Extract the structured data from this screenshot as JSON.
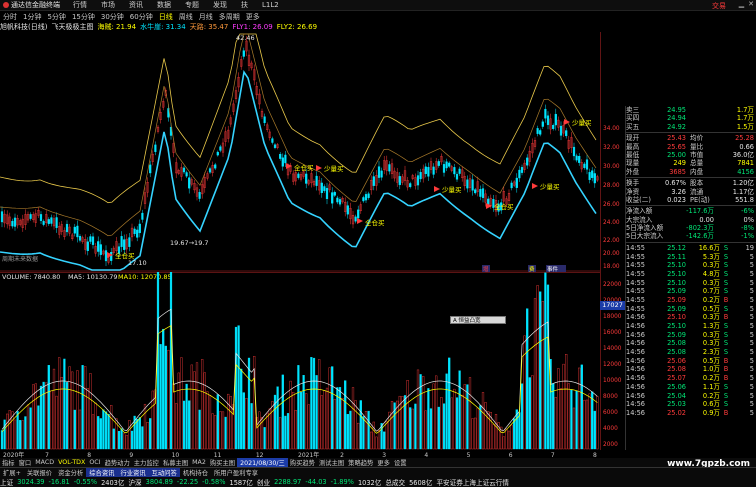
{
  "menubar": {
    "app_title": "通达信金融终端",
    "items": [
      "行情",
      "市场",
      "资讯",
      "数据",
      "专题",
      "发现",
      "扶",
      "L1L2"
    ],
    "brand": "交易"
  },
  "periods": [
    {
      "label": "分时",
      "active": false
    },
    {
      "label": "1分钟",
      "active": false
    },
    {
      "label": "5分钟",
      "active": false
    },
    {
      "label": "15分钟",
      "active": false
    },
    {
      "label": "30分钟",
      "active": false
    },
    {
      "label": "60分钟",
      "active": false
    },
    {
      "label": "日线",
      "active": true
    },
    {
      "label": "周线",
      "active": false
    },
    {
      "label": "月线",
      "active": false
    },
    {
      "label": "多周期",
      "active": false
    },
    {
      "label": "更多",
      "active": false
    }
  ],
  "legend": {
    "stock": "旭帆科技(日线)",
    "indicator": "飞天极极主图",
    "item1": "海贼: 21.94",
    "item2": "水牛崖: 31.34",
    "item3": "天路: 35.47",
    "item4": "FLY1: 26.09",
    "item5": "FLY2: 26.69"
  },
  "main_chart": {
    "high_label": "42.46",
    "low_label1": "17.10",
    "low_label2": "19.67→19.7",
    "note_label": "周期未来数据",
    "signals": [
      "全仓买",
      "全仓买",
      "全仓买",
      "全仓买",
      "少量买",
      "少量买",
      "少量买",
      "少量买"
    ],
    "bottom_tags": [
      "增",
      "费",
      "事件"
    ],
    "y_ticks": [
      "34.00",
      "32.00",
      "30.00",
      "28.00",
      "26.00",
      "24.00",
      "22.00",
      "20.00",
      "18.00"
    ]
  },
  "volume_chart": {
    "header": "VOLUME: 7840.80",
    "ma5": "MA5: 10130.79",
    "ma10": "MA10: 12070.85",
    "y_ticks": [
      "22000",
      "20000",
      "18000",
      "16000",
      "14000",
      "12000",
      "10000",
      "8000",
      "6000",
      "4000",
      "2000"
    ],
    "last_price_box": "17027",
    "popup": "A 恒益凸宽"
  },
  "quote_panel": {
    "asks": [
      {
        "label": "卖三",
        "price": "24.95",
        "vol": "1.7万"
      },
      {
        "label": "买四",
        "price": "24.94",
        "vol": "1.7万"
      },
      {
        "label": "买五",
        "price": "24.92",
        "vol": "1.5万"
      }
    ],
    "stats": [
      {
        "k": "现开",
        "v1": "25.43",
        "k2": "均价",
        "v2": "25.28"
      },
      {
        "k": "最高",
        "v1": "25.65",
        "k2": "量比",
        "v2": "0.66"
      },
      {
        "k": "最低",
        "v1": "25.00",
        "k2": "市值",
        "v2": "36.0亿"
      },
      {
        "k": "现量",
        "v1": "249",
        "k2": "总量",
        "v2": "7841"
      },
      {
        "k": "外盘",
        "v1": "3685",
        "k2": "内盘",
        "v2": "4156"
      },
      {
        "k": "换手",
        "v1": "0.67%",
        "k2": "股本",
        "v2": "1.20亿"
      },
      {
        "k": "净资",
        "v1": "3.26",
        "k2": "流通",
        "v2": "1.17亿"
      },
      {
        "k": "收益(二)",
        "v1": "0.023",
        "k2": "PE(动)",
        "v2": "551.8"
      }
    ],
    "flows": [
      {
        "k": "净流入额",
        "v": "-117.6万",
        "p": "-6%"
      },
      {
        "k": "大宗流入",
        "v": "0.00",
        "p": "0%"
      },
      {
        "k": "5日净流入额",
        "v": "-802.3万",
        "p": "-8%"
      },
      {
        "k": "5日大宗流入",
        "v": "-142.6万",
        "p": "-1%"
      }
    ],
    "ticks": [
      {
        "t": "14:55",
        "p": "25.12",
        "v": "16.6万",
        "bs": "S",
        "n": "19"
      },
      {
        "t": "14:55",
        "p": "25.11",
        "v": "5.3万",
        "bs": "S",
        "n": "5"
      },
      {
        "t": "14:55",
        "p": "25.10",
        "v": "0.3万",
        "bs": "S",
        "n": "5"
      },
      {
        "t": "14:55",
        "p": "25.10",
        "v": "4.8万",
        "bs": "S",
        "n": "5"
      },
      {
        "t": "14:55",
        "p": "25.10",
        "v": "0.3万",
        "bs": "S",
        "n": "5"
      },
      {
        "t": "14:55",
        "p": "25.09",
        "v": "0.7万",
        "bs": "S",
        "n": "5"
      },
      {
        "t": "14:55",
        "p": "25.09",
        "v": "0.2万",
        "bs": "B",
        "n": "5"
      },
      {
        "t": "14:55",
        "p": "25.09",
        "v": "0.5万",
        "bs": "S",
        "n": "5"
      },
      {
        "t": "14:56",
        "p": "25.10",
        "v": "0.3万",
        "bs": "B",
        "n": "5"
      },
      {
        "t": "14:56",
        "p": "25.10",
        "v": "1.3万",
        "bs": "S",
        "n": "5"
      },
      {
        "t": "14:56",
        "p": "25.09",
        "v": "0.3万",
        "bs": "S",
        "n": "5"
      },
      {
        "t": "14:56",
        "p": "25.08",
        "v": "0.3万",
        "bs": "S",
        "n": "5"
      },
      {
        "t": "14:56",
        "p": "25.08",
        "v": "2.3万",
        "bs": "S",
        "n": "5"
      },
      {
        "t": "14:56",
        "p": "25.06",
        "v": "0.5万",
        "bs": "B",
        "n": "5"
      },
      {
        "t": "14:56",
        "p": "25.08",
        "v": "1.0万",
        "bs": "B",
        "n": "5"
      },
      {
        "t": "14:56",
        "p": "25.07",
        "v": "0.2万",
        "bs": "B",
        "n": "5"
      },
      {
        "t": "14:56",
        "p": "25.06",
        "v": "1.1万",
        "bs": "S",
        "n": "5"
      },
      {
        "t": "14:56",
        "p": "25.04",
        "v": "0.2万",
        "bs": "S",
        "n": "5"
      },
      {
        "t": "14:56",
        "p": "25.03",
        "v": "0.6万",
        "bs": "S",
        "n": "5"
      },
      {
        "t": "14:56",
        "p": "25.02",
        "v": "0.9万",
        "bs": "B",
        "n": "5"
      }
    ]
  },
  "tabs": [
    "指标",
    "窗口",
    "MACD",
    "VOL-TDX",
    "OCI",
    "趋势动力",
    "主力监控",
    "私募主图",
    "MA2",
    "购买主图",
    "购买趋势",
    "测试主图",
    "策略趋势",
    "更多",
    "设置"
  ],
  "date_tab": "2021/08/30/三",
  "xaxis_labels": [
    "2020年",
    "7",
    "8",
    "9",
    "10",
    "11",
    "12",
    "2021年",
    "2",
    "3",
    "4",
    "5",
    "6",
    "7",
    "8"
  ],
  "bottom_buttons": [
    "扩展+",
    "关联报价",
    "资金分析",
    "综合资讯",
    "行业资讯",
    "互动问答",
    "机构持仓",
    "所用户盈利专享"
  ],
  "statusbar": {
    "sh_label": "上证",
    "sh_val": "3024.39",
    "sh_chg": "-16.81",
    "sh_pct": "-0.55%",
    "sh_amt": "2403亿",
    "sz_label": "沪深",
    "sz_val": "3804.89",
    "sz_chg": "-22.25",
    "sz_pct": "-0.58%",
    "sz_amt": "1587亿",
    "cy_label": "创业",
    "cy_val": "2288.97",
    "cy_chg": "-44.03",
    "cy_pct": "-1.89%",
    "cy_amt": "1032亿",
    "total_label": "总成交",
    "total_val": "5608亿",
    "broker": "平安证券上海上证云行情"
  },
  "watermark": "www.7gpzb.com",
  "colors": {
    "up": "#ff3b3b",
    "down": "#00e676",
    "accent": "#ffff00",
    "cyan": "#00e5ff"
  }
}
